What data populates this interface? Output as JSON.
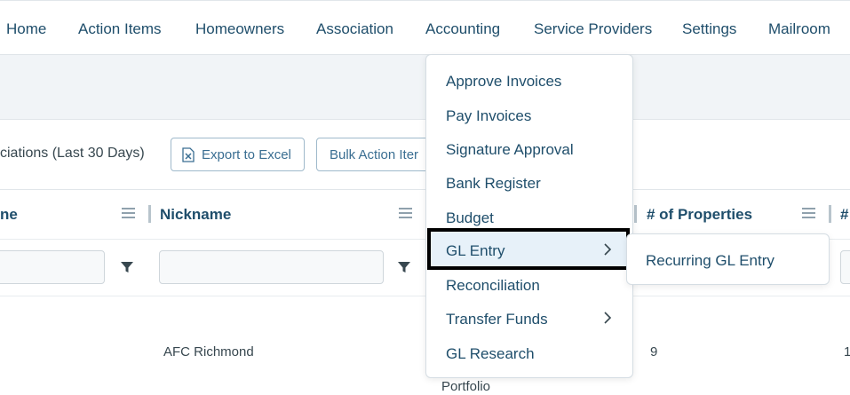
{
  "nav": {
    "items": [
      "Home",
      "Action Items",
      "Homeowners",
      "Association",
      "Accounting",
      "Service Providers",
      "Settings",
      "Mailroom"
    ]
  },
  "toolbar": {
    "title": "ciations (Last 30 Days)",
    "export_label": "Export to Excel",
    "bulk_label": "Bulk Action Iter"
  },
  "grid": {
    "headers": [
      "ne",
      "Nickname",
      "# of Properties",
      "#"
    ],
    "row": {
      "nickname": "AFC Richmond",
      "properties": "9",
      "last_col": "1",
      "partial_below": "Portfolio"
    }
  },
  "accounting_menu": {
    "items": [
      "Approve Invoices",
      "Pay Invoices",
      "Signature Approval",
      "Bank Register",
      "Budget",
      "GL Entry",
      "Reconciliation",
      "Transfer Funds",
      "GL Research"
    ],
    "selected": "GL Entry",
    "submenu": [
      "Recurring GL Entry"
    ]
  },
  "colors": {
    "primary_text": "#1f4e6b",
    "highlight_bg": "#e7f1f9",
    "highlight_border": "#000000",
    "band_bg": "#f1f4f7"
  },
  "icons": [
    "excel-icon",
    "column-menu-icon",
    "filter-funnel-icon",
    "chevron-right-icon"
  ]
}
